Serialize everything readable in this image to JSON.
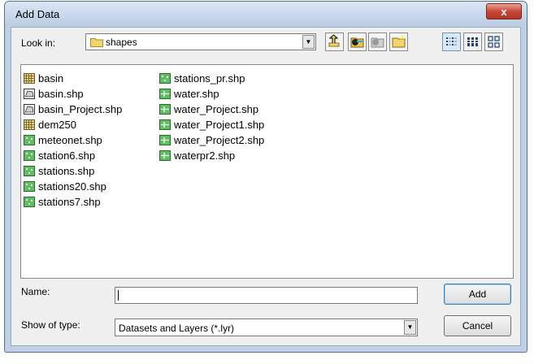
{
  "window": {
    "title": "Add Data",
    "close_glyph": "x"
  },
  "look_in": {
    "label": "Look in:",
    "value": "shapes"
  },
  "toolbar": {
    "buttons": [
      "up-one-level-icon",
      "connect-folder-icon",
      "disconnect-folder-icon",
      "new-folder-icon",
      "list-view-icon",
      "details-view-icon",
      "thumbnails-view-icon"
    ]
  },
  "files": [
    {
      "name": "basin",
      "type": "raster"
    },
    {
      "name": "basin.shp",
      "type": "polygon"
    },
    {
      "name": "basin_Project.shp",
      "type": "polygon"
    },
    {
      "name": "dem250",
      "type": "raster"
    },
    {
      "name": "meteonet.shp",
      "type": "point"
    },
    {
      "name": "station6.shp",
      "type": "point"
    },
    {
      "name": "stations.shp",
      "type": "point"
    },
    {
      "name": "stations20.shp",
      "type": "point"
    },
    {
      "name": "stations7.shp",
      "type": "point"
    },
    {
      "name": "stations_pr.shp",
      "type": "point"
    },
    {
      "name": "water.shp",
      "type": "line"
    },
    {
      "name": "water_Project.shp",
      "type": "line"
    },
    {
      "name": "water_Project1.shp",
      "type": "line"
    },
    {
      "name": "water_Project2.shp",
      "type": "line"
    },
    {
      "name": "waterpr2.shp",
      "type": "line"
    }
  ],
  "name_field": {
    "label": "Name:",
    "value": ""
  },
  "show_type": {
    "label": "Show of type:",
    "value": "Datasets and Layers (*.lyr)"
  },
  "buttons": {
    "add": "Add",
    "cancel": "Cancel"
  }
}
